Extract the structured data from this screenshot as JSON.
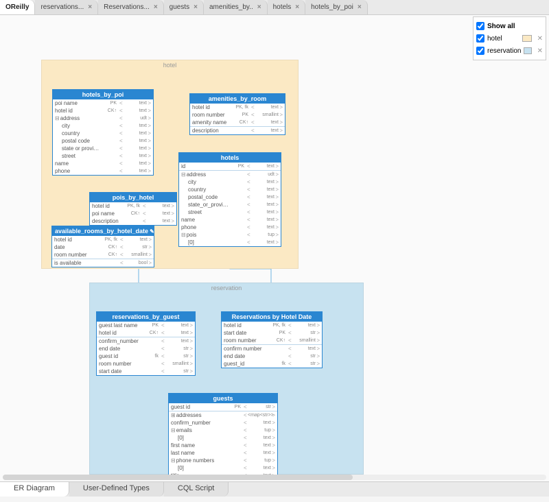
{
  "tabs": [
    {
      "label": "OReilly",
      "closable": false,
      "active": true
    },
    {
      "label": "reservations...",
      "closable": true
    },
    {
      "label": "Reservations...",
      "closable": true
    },
    {
      "label": "guests",
      "closable": true
    },
    {
      "label": "amenities_by..",
      "closable": true
    },
    {
      "label": "hotels",
      "closable": true
    },
    {
      "label": "hotels_by_poi",
      "closable": true
    }
  ],
  "legend": {
    "showAll": "Show all",
    "items": [
      {
        "label": "hotel",
        "color": "#fbe9c4"
      },
      {
        "label": "reservation",
        "color": "#c7e2f0"
      }
    ]
  },
  "groups": {
    "hotel": {
      "label": "hotel"
    },
    "reservation": {
      "label": "reservation"
    }
  },
  "entities": {
    "hotels_by_poi": {
      "title": "hotels_by_poi",
      "rows": [
        {
          "name": "poi name",
          "key": "PK",
          "type": "text"
        },
        {
          "name": "hotel id",
          "key": "CK↑",
          "type": "text"
        },
        {
          "name": "address",
          "key": "",
          "type": "udt",
          "expand": "⊟"
        },
        {
          "name": "city",
          "key": "",
          "type": "text",
          "indent": 1
        },
        {
          "name": "country",
          "key": "",
          "type": "text",
          "indent": 1
        },
        {
          "name": "postal code",
          "key": "",
          "type": "text",
          "indent": 1
        },
        {
          "name": "state or province",
          "key": "",
          "type": "text",
          "indent": 1
        },
        {
          "name": "street",
          "key": "",
          "type": "text",
          "indent": 1
        },
        {
          "name": "name",
          "key": "",
          "type": "text"
        },
        {
          "name": "phone",
          "key": "",
          "type": "text"
        }
      ]
    },
    "pois_by_hotel": {
      "title": "pois_by_hotel",
      "rows": [
        {
          "name": "hotel id",
          "key": "PK, fk",
          "type": "text"
        },
        {
          "name": "poi name",
          "key": "CK↑",
          "type": "text"
        },
        {
          "name": "description",
          "key": "",
          "type": "text"
        }
      ]
    },
    "available_rooms": {
      "title": "available_rooms_by_hotel_date",
      "rows": [
        {
          "name": "hotel id",
          "key": "PK, fk",
          "type": "text"
        },
        {
          "name": "date",
          "key": "CK↑",
          "type": "str"
        },
        {
          "name": "room number",
          "key": "CK↑",
          "type": "smallint"
        },
        {
          "name": "is available",
          "key": "",
          "type": "bool",
          "sep": true
        }
      ]
    },
    "amenities_by_room": {
      "title": "amenities_by_room",
      "rows": [
        {
          "name": "hotel id",
          "key": "PK, fk",
          "type": "text"
        },
        {
          "name": "room number",
          "key": "PK",
          "type": "smallint"
        },
        {
          "name": "amenity name",
          "key": "CK↑",
          "type": "text"
        },
        {
          "name": "description",
          "key": "",
          "type": "text",
          "sep": true
        }
      ]
    },
    "hotels": {
      "title": "hotels",
      "rows": [
        {
          "name": "id",
          "key": "PK",
          "type": "text"
        },
        {
          "name": "address",
          "key": "",
          "type": "udt",
          "expand": "⊟",
          "sep": true
        },
        {
          "name": "city",
          "key": "",
          "type": "text",
          "indent": 1
        },
        {
          "name": "country",
          "key": "",
          "type": "text",
          "indent": 1
        },
        {
          "name": "postal_code",
          "key": "",
          "type": "text",
          "indent": 1
        },
        {
          "name": "state_or_province",
          "key": "",
          "type": "text",
          "indent": 1
        },
        {
          "name": "street",
          "key": "",
          "type": "text",
          "indent": 1
        },
        {
          "name": "name",
          "key": "",
          "type": "text"
        },
        {
          "name": "phone",
          "key": "",
          "type": "text"
        },
        {
          "name": "pois",
          "key": "",
          "type": "tup",
          "expand": "⊟"
        },
        {
          "name": "[0]",
          "key": "",
          "type": "text",
          "indent": 1
        }
      ]
    },
    "reservations_by_guest": {
      "title": "reservations_by_guest",
      "rows": [
        {
          "name": "guest last name",
          "key": "PK",
          "type": "text"
        },
        {
          "name": "hotel id",
          "key": "CK↑",
          "type": "text"
        },
        {
          "name": "confirm_number",
          "key": "",
          "type": "text",
          "sep": true
        },
        {
          "name": "end date",
          "key": "",
          "type": "str"
        },
        {
          "name": "guest id",
          "key": "fk",
          "type": "str"
        },
        {
          "name": "room number",
          "key": "",
          "type": "smallint"
        },
        {
          "name": "start date",
          "key": "",
          "type": "str"
        }
      ]
    },
    "reservations_by_hotel_date": {
      "title": "Reservations by Hotel Date",
      "rows": [
        {
          "name": "hotel id",
          "key": "PK, fk",
          "type": "text"
        },
        {
          "name": "start date",
          "key": "PK",
          "type": "str"
        },
        {
          "name": "room number",
          "key": "CK↑",
          "type": "smallint"
        },
        {
          "name": "confirm number",
          "key": "",
          "type": "text",
          "sep": true
        },
        {
          "name": "end date",
          "key": "",
          "type": "str"
        },
        {
          "name": "guest_id",
          "key": "fk",
          "type": "str"
        }
      ]
    },
    "guests": {
      "title": "guests",
      "rows": [
        {
          "name": "guest id",
          "key": "PK",
          "type": "str"
        },
        {
          "name": "addresses",
          "key": "",
          "type": "<map<str>>",
          "expand": "⊞",
          "sep": true
        },
        {
          "name": "confirm_number",
          "key": "",
          "type": "text"
        },
        {
          "name": "emails",
          "key": "",
          "type": "tup",
          "expand": "⊟"
        },
        {
          "name": "[0]",
          "key": "",
          "type": "text",
          "indent": 1
        },
        {
          "name": "first name",
          "key": "",
          "type": "text"
        },
        {
          "name": "last name",
          "key": "",
          "type": "text"
        },
        {
          "name": "phone numbers",
          "key": "",
          "type": "tup",
          "expand": "⊟"
        },
        {
          "name": "[0]",
          "key": "",
          "type": "text",
          "indent": 1
        },
        {
          "name": "title",
          "key": "",
          "type": "text"
        }
      ]
    }
  },
  "bottomTabs": [
    {
      "label": "ER Diagram",
      "active": true
    },
    {
      "label": "User-Defined Types"
    },
    {
      "label": "CQL Script"
    }
  ]
}
